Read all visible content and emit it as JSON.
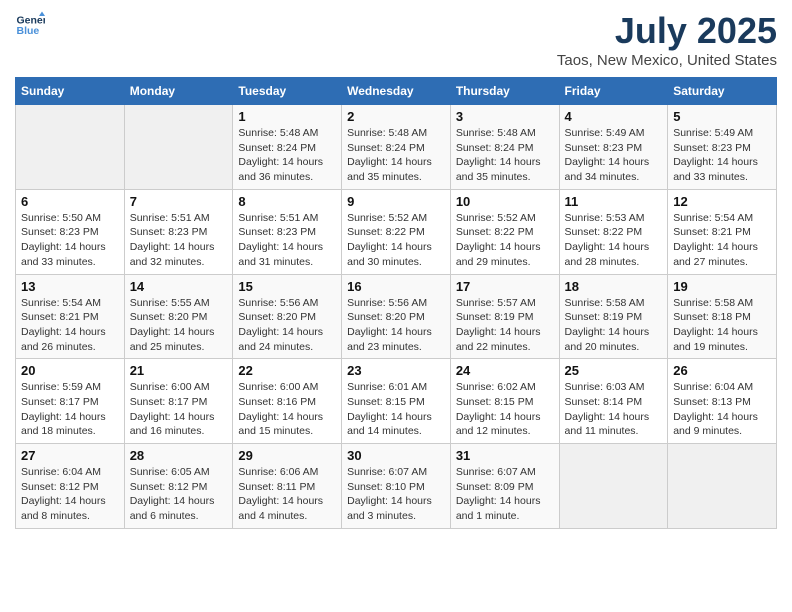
{
  "logo": {
    "line1": "General",
    "line2": "Blue"
  },
  "title": "July 2025",
  "subtitle": "Taos, New Mexico, United States",
  "days_of_week": [
    "Sunday",
    "Monday",
    "Tuesday",
    "Wednesday",
    "Thursday",
    "Friday",
    "Saturday"
  ],
  "weeks": [
    [
      {
        "day": "",
        "info": ""
      },
      {
        "day": "",
        "info": ""
      },
      {
        "day": "1",
        "info": "Sunrise: 5:48 AM\nSunset: 8:24 PM\nDaylight: 14 hours and 36 minutes."
      },
      {
        "day": "2",
        "info": "Sunrise: 5:48 AM\nSunset: 8:24 PM\nDaylight: 14 hours and 35 minutes."
      },
      {
        "day": "3",
        "info": "Sunrise: 5:48 AM\nSunset: 8:24 PM\nDaylight: 14 hours and 35 minutes."
      },
      {
        "day": "4",
        "info": "Sunrise: 5:49 AM\nSunset: 8:23 PM\nDaylight: 14 hours and 34 minutes."
      },
      {
        "day": "5",
        "info": "Sunrise: 5:49 AM\nSunset: 8:23 PM\nDaylight: 14 hours and 33 minutes."
      }
    ],
    [
      {
        "day": "6",
        "info": "Sunrise: 5:50 AM\nSunset: 8:23 PM\nDaylight: 14 hours and 33 minutes."
      },
      {
        "day": "7",
        "info": "Sunrise: 5:51 AM\nSunset: 8:23 PM\nDaylight: 14 hours and 32 minutes."
      },
      {
        "day": "8",
        "info": "Sunrise: 5:51 AM\nSunset: 8:23 PM\nDaylight: 14 hours and 31 minutes."
      },
      {
        "day": "9",
        "info": "Sunrise: 5:52 AM\nSunset: 8:22 PM\nDaylight: 14 hours and 30 minutes."
      },
      {
        "day": "10",
        "info": "Sunrise: 5:52 AM\nSunset: 8:22 PM\nDaylight: 14 hours and 29 minutes."
      },
      {
        "day": "11",
        "info": "Sunrise: 5:53 AM\nSunset: 8:22 PM\nDaylight: 14 hours and 28 minutes."
      },
      {
        "day": "12",
        "info": "Sunrise: 5:54 AM\nSunset: 8:21 PM\nDaylight: 14 hours and 27 minutes."
      }
    ],
    [
      {
        "day": "13",
        "info": "Sunrise: 5:54 AM\nSunset: 8:21 PM\nDaylight: 14 hours and 26 minutes."
      },
      {
        "day": "14",
        "info": "Sunrise: 5:55 AM\nSunset: 8:20 PM\nDaylight: 14 hours and 25 minutes."
      },
      {
        "day": "15",
        "info": "Sunrise: 5:56 AM\nSunset: 8:20 PM\nDaylight: 14 hours and 24 minutes."
      },
      {
        "day": "16",
        "info": "Sunrise: 5:56 AM\nSunset: 8:20 PM\nDaylight: 14 hours and 23 minutes."
      },
      {
        "day": "17",
        "info": "Sunrise: 5:57 AM\nSunset: 8:19 PM\nDaylight: 14 hours and 22 minutes."
      },
      {
        "day": "18",
        "info": "Sunrise: 5:58 AM\nSunset: 8:19 PM\nDaylight: 14 hours and 20 minutes."
      },
      {
        "day": "19",
        "info": "Sunrise: 5:58 AM\nSunset: 8:18 PM\nDaylight: 14 hours and 19 minutes."
      }
    ],
    [
      {
        "day": "20",
        "info": "Sunrise: 5:59 AM\nSunset: 8:17 PM\nDaylight: 14 hours and 18 minutes."
      },
      {
        "day": "21",
        "info": "Sunrise: 6:00 AM\nSunset: 8:17 PM\nDaylight: 14 hours and 16 minutes."
      },
      {
        "day": "22",
        "info": "Sunrise: 6:00 AM\nSunset: 8:16 PM\nDaylight: 14 hours and 15 minutes."
      },
      {
        "day": "23",
        "info": "Sunrise: 6:01 AM\nSunset: 8:15 PM\nDaylight: 14 hours and 14 minutes."
      },
      {
        "day": "24",
        "info": "Sunrise: 6:02 AM\nSunset: 8:15 PM\nDaylight: 14 hours and 12 minutes."
      },
      {
        "day": "25",
        "info": "Sunrise: 6:03 AM\nSunset: 8:14 PM\nDaylight: 14 hours and 11 minutes."
      },
      {
        "day": "26",
        "info": "Sunrise: 6:04 AM\nSunset: 8:13 PM\nDaylight: 14 hours and 9 minutes."
      }
    ],
    [
      {
        "day": "27",
        "info": "Sunrise: 6:04 AM\nSunset: 8:12 PM\nDaylight: 14 hours and 8 minutes."
      },
      {
        "day": "28",
        "info": "Sunrise: 6:05 AM\nSunset: 8:12 PM\nDaylight: 14 hours and 6 minutes."
      },
      {
        "day": "29",
        "info": "Sunrise: 6:06 AM\nSunset: 8:11 PM\nDaylight: 14 hours and 4 minutes."
      },
      {
        "day": "30",
        "info": "Sunrise: 6:07 AM\nSunset: 8:10 PM\nDaylight: 14 hours and 3 minutes."
      },
      {
        "day": "31",
        "info": "Sunrise: 6:07 AM\nSunset: 8:09 PM\nDaylight: 14 hours and 1 minute."
      },
      {
        "day": "",
        "info": ""
      },
      {
        "day": "",
        "info": ""
      }
    ]
  ]
}
